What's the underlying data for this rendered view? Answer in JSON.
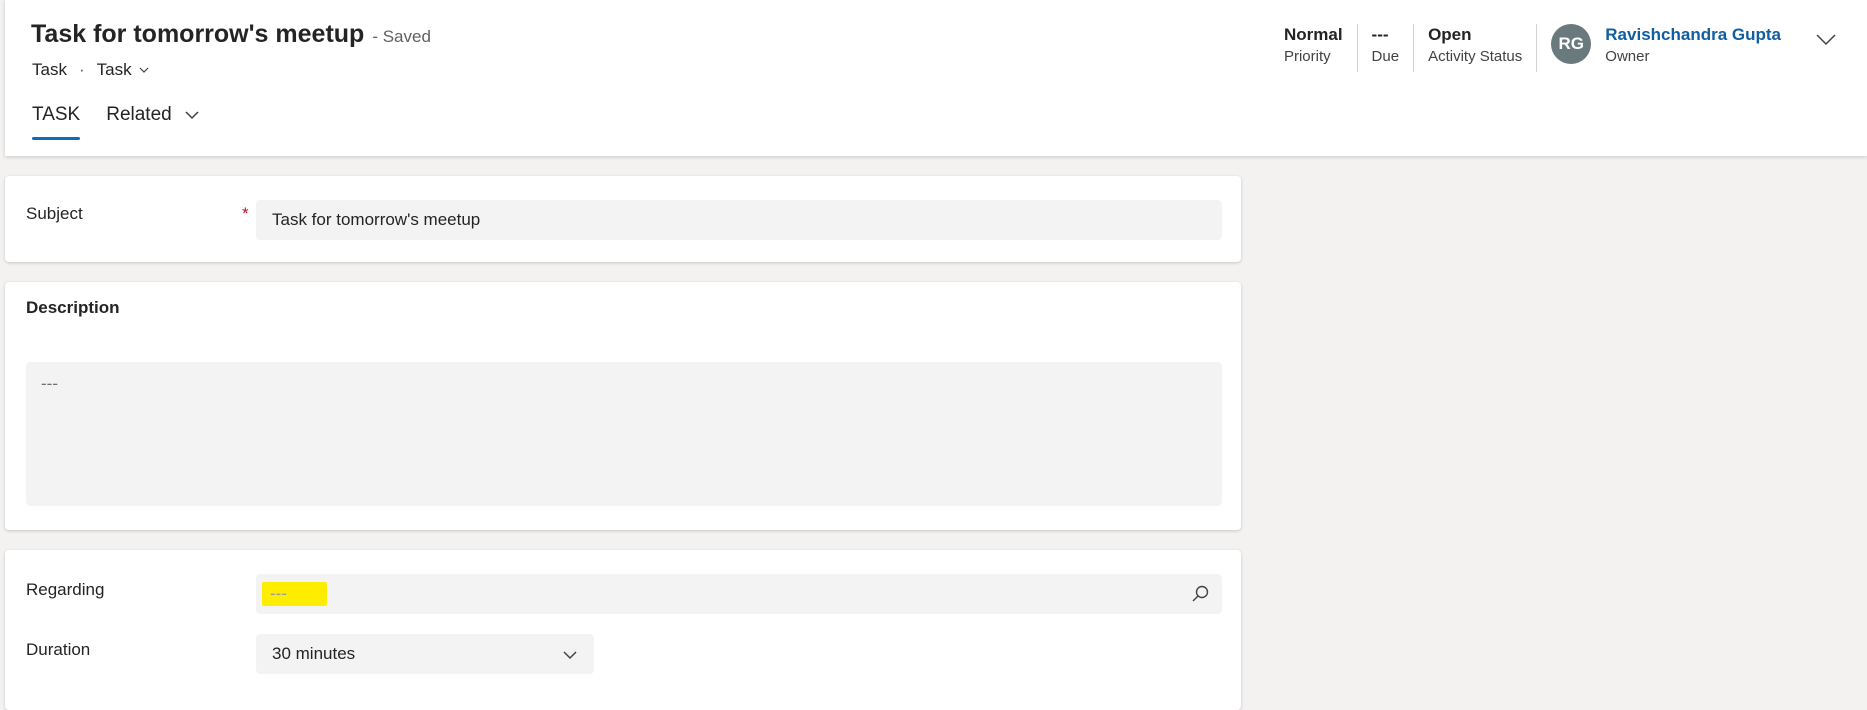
{
  "header": {
    "title": "Task for tomorrow's meetup",
    "save_status": "- Saved",
    "entity_name": "Task",
    "separator": "·",
    "form_name": "Task",
    "tabs": [
      {
        "label": "TASK",
        "active": true
      },
      {
        "label": "Related",
        "active": false
      }
    ],
    "fields": [
      {
        "value": "Normal",
        "label": "Priority"
      },
      {
        "value": "---",
        "label": "Due"
      },
      {
        "value": "Open",
        "label": "Activity Status"
      }
    ],
    "owner": {
      "initials": "RG",
      "name": "Ravishchandra Gupta",
      "label": "Owner"
    }
  },
  "form": {
    "subject": {
      "label": "Subject",
      "required_mark": "*",
      "value": "Task for tomorrow's meetup"
    },
    "description": {
      "section_title": "Description",
      "value": "---"
    },
    "regarding": {
      "label": "Regarding",
      "value": "---"
    },
    "duration": {
      "label": "Duration",
      "value": "30 minutes"
    }
  },
  "colors": {
    "accent": "#0f6cbd",
    "owner_link": "#115ea3",
    "avatar_bg": "#69797e",
    "required": "#c50f1f",
    "highlight": "#ffed00"
  }
}
